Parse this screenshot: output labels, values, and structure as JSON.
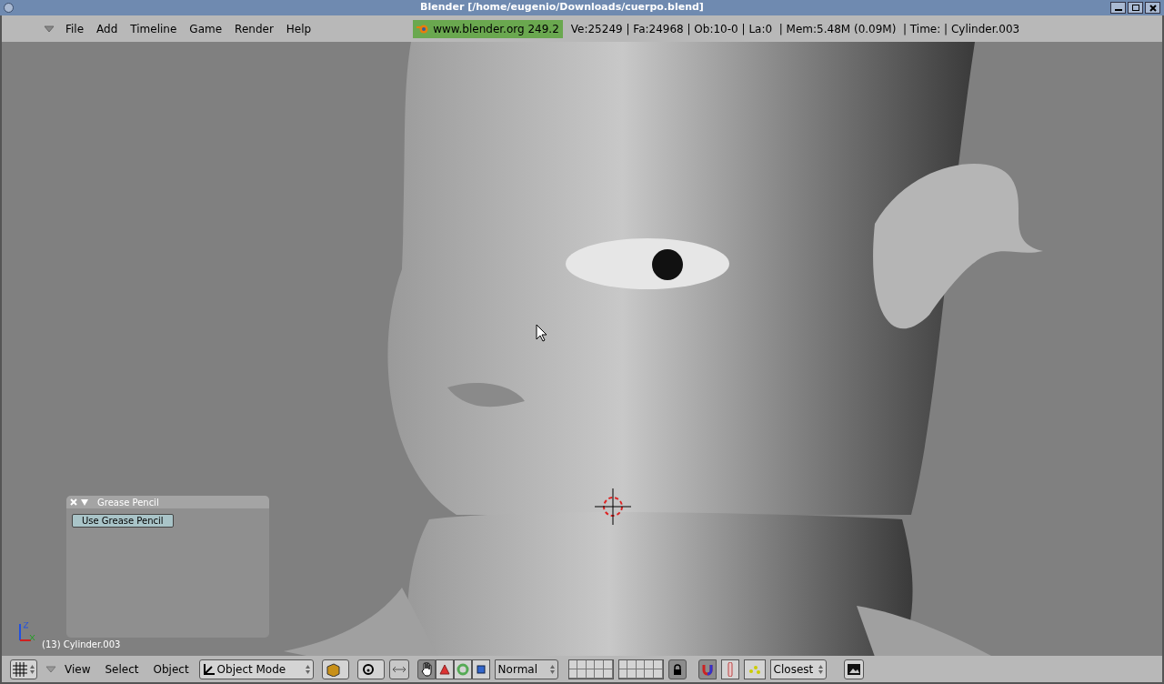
{
  "window": {
    "title": "Blender [/home/eugenio/Downloads/cuerpo.blend]"
  },
  "menu": [
    "File",
    "Add",
    "Timeline",
    "Game",
    "Render",
    "Help"
  ],
  "splash": "www.blender.org 249.2",
  "stats": "Ve:25249 | Fa:24968 | Ob:10-0 | La:0  | Mem:5.48M (0.09M)  | Time: | Cylinder.003",
  "grease_panel": {
    "title": "Grease Pencil",
    "button": "Use Grease Pencil"
  },
  "object_label": "(13) Cylinder.003",
  "header": {
    "menus": [
      "View",
      "Select",
      "Object"
    ],
    "mode": "Object Mode",
    "transform_space": "Normal",
    "snap_target": "Closest",
    "manipulators": [
      {
        "kind": "hand",
        "pressed": true
      },
      {
        "kind": "translate",
        "pressed": false
      },
      {
        "kind": "rotate",
        "pressed": false
      },
      {
        "kind": "scale",
        "pressed": false
      }
    ],
    "snap": {
      "pressed": true
    },
    "layers_lock": {
      "pressed": true
    }
  }
}
